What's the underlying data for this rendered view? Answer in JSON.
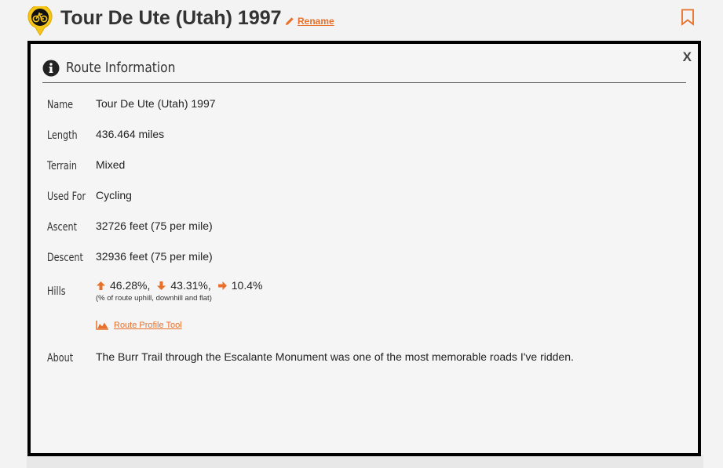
{
  "header": {
    "title": "Tour De Ute (Utah) 1997",
    "rename_label": "Rename"
  },
  "panel": {
    "title": "Route Information",
    "close_label": "X"
  },
  "details": {
    "name": {
      "label": "Name",
      "value": "Tour De Ute (Utah) 1997"
    },
    "length": {
      "label": "Length",
      "value": "436.464 miles"
    },
    "terrain": {
      "label": "Terrain",
      "value": "Mixed"
    },
    "used_for": {
      "label": "Used For",
      "value": "Cycling"
    },
    "ascent": {
      "label": "Ascent",
      "value": "32726 feet (75 per mile)"
    },
    "descent": {
      "label": "Descent",
      "value": "32936 feet (75 per mile)"
    },
    "hills": {
      "label": "Hills",
      "uphill": "46.28%,",
      "downhill": "43.31%,",
      "flat": "10.4%",
      "note": "(% of route uphill, downhill and flat)"
    },
    "profile_tool_label": "Route Profile Tool",
    "about": {
      "label": "About",
      "value": "The Burr Trail through the Escalante Monument was one of the most memorable roads I've ridden."
    }
  },
  "colors": {
    "accent": "#e8702a",
    "icon_yellow": "#f5c518",
    "panel_border": "#000000"
  },
  "icons": [
    "bicycle-pin-icon",
    "pencil-icon",
    "bookmark-icon",
    "info-icon",
    "arrow-up-icon",
    "arrow-down-icon",
    "arrow-right-icon",
    "profile-chart-icon"
  ]
}
